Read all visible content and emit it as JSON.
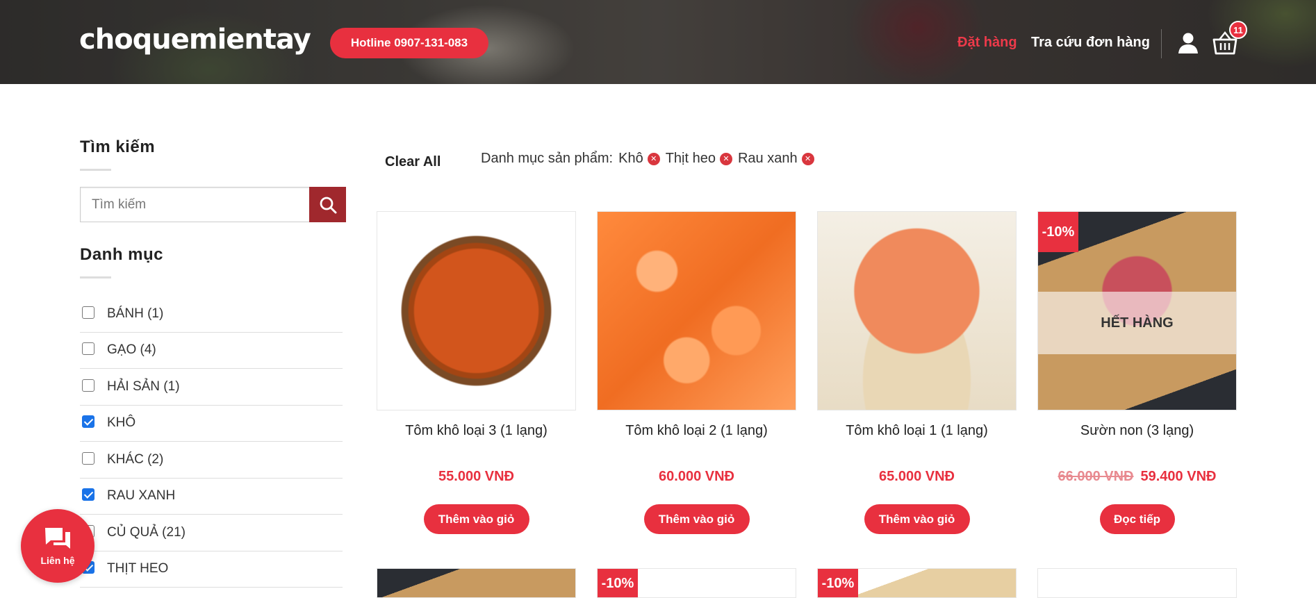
{
  "header": {
    "logo": "choquemientay",
    "hotline": "Hotline 0907-131-083",
    "nav_order": "Đặt hàng",
    "nav_lookup": "Tra cứu đơn hàng",
    "cart_count": "11"
  },
  "sidebar": {
    "search_title": "Tìm kiếm",
    "search_placeholder": "Tìm kiếm",
    "category_title": "Danh mục",
    "categories": [
      {
        "label": "BÁNH (1)",
        "checked": false
      },
      {
        "label": "GẠO (4)",
        "checked": false
      },
      {
        "label": "HẢI SẢN (1)",
        "checked": false
      },
      {
        "label": "KHÔ",
        "checked": true
      },
      {
        "label": "KHÁC (2)",
        "checked": false
      },
      {
        "label": "RAU XANH",
        "checked": true
      },
      {
        "label": "CỦ QUẢ (21)",
        "checked": false
      },
      {
        "label": "THỊT HEO",
        "checked": true
      }
    ]
  },
  "filters": {
    "clear_all": "Clear All",
    "label": "Danh mục sản phẩm:",
    "active": [
      "Khô",
      "Thịt heo",
      "Rau xanh"
    ]
  },
  "products": [
    {
      "name": "Tôm khô loại 3 (1 lạng)",
      "price": "55.000 VNĐ",
      "old_price": "",
      "button": "Thêm vào giỏ",
      "badge": "",
      "soldout": ""
    },
    {
      "name": "Tôm khô loại 2 (1 lạng)",
      "price": "60.000 VNĐ",
      "old_price": "",
      "button": "Thêm vào giỏ",
      "badge": "",
      "soldout": ""
    },
    {
      "name": "Tôm khô loại 1 (1 lạng)",
      "price": "65.000 VNĐ",
      "old_price": "",
      "button": "Thêm vào giỏ",
      "badge": "",
      "soldout": ""
    },
    {
      "name": "Sườn non (3 lạng)",
      "price": "59.400 VNĐ",
      "old_price": "66.000 VNĐ",
      "button": "Đọc tiếp",
      "badge": "-10%",
      "soldout": "HẾT HÀNG"
    }
  ],
  "row2_badges": [
    "-10%",
    "-10%"
  ],
  "chat": {
    "label": "Liên hệ"
  },
  "colors": {
    "accent": "#e8303f",
    "search_button": "#a0282d",
    "checkbox": "#1a73e8"
  }
}
